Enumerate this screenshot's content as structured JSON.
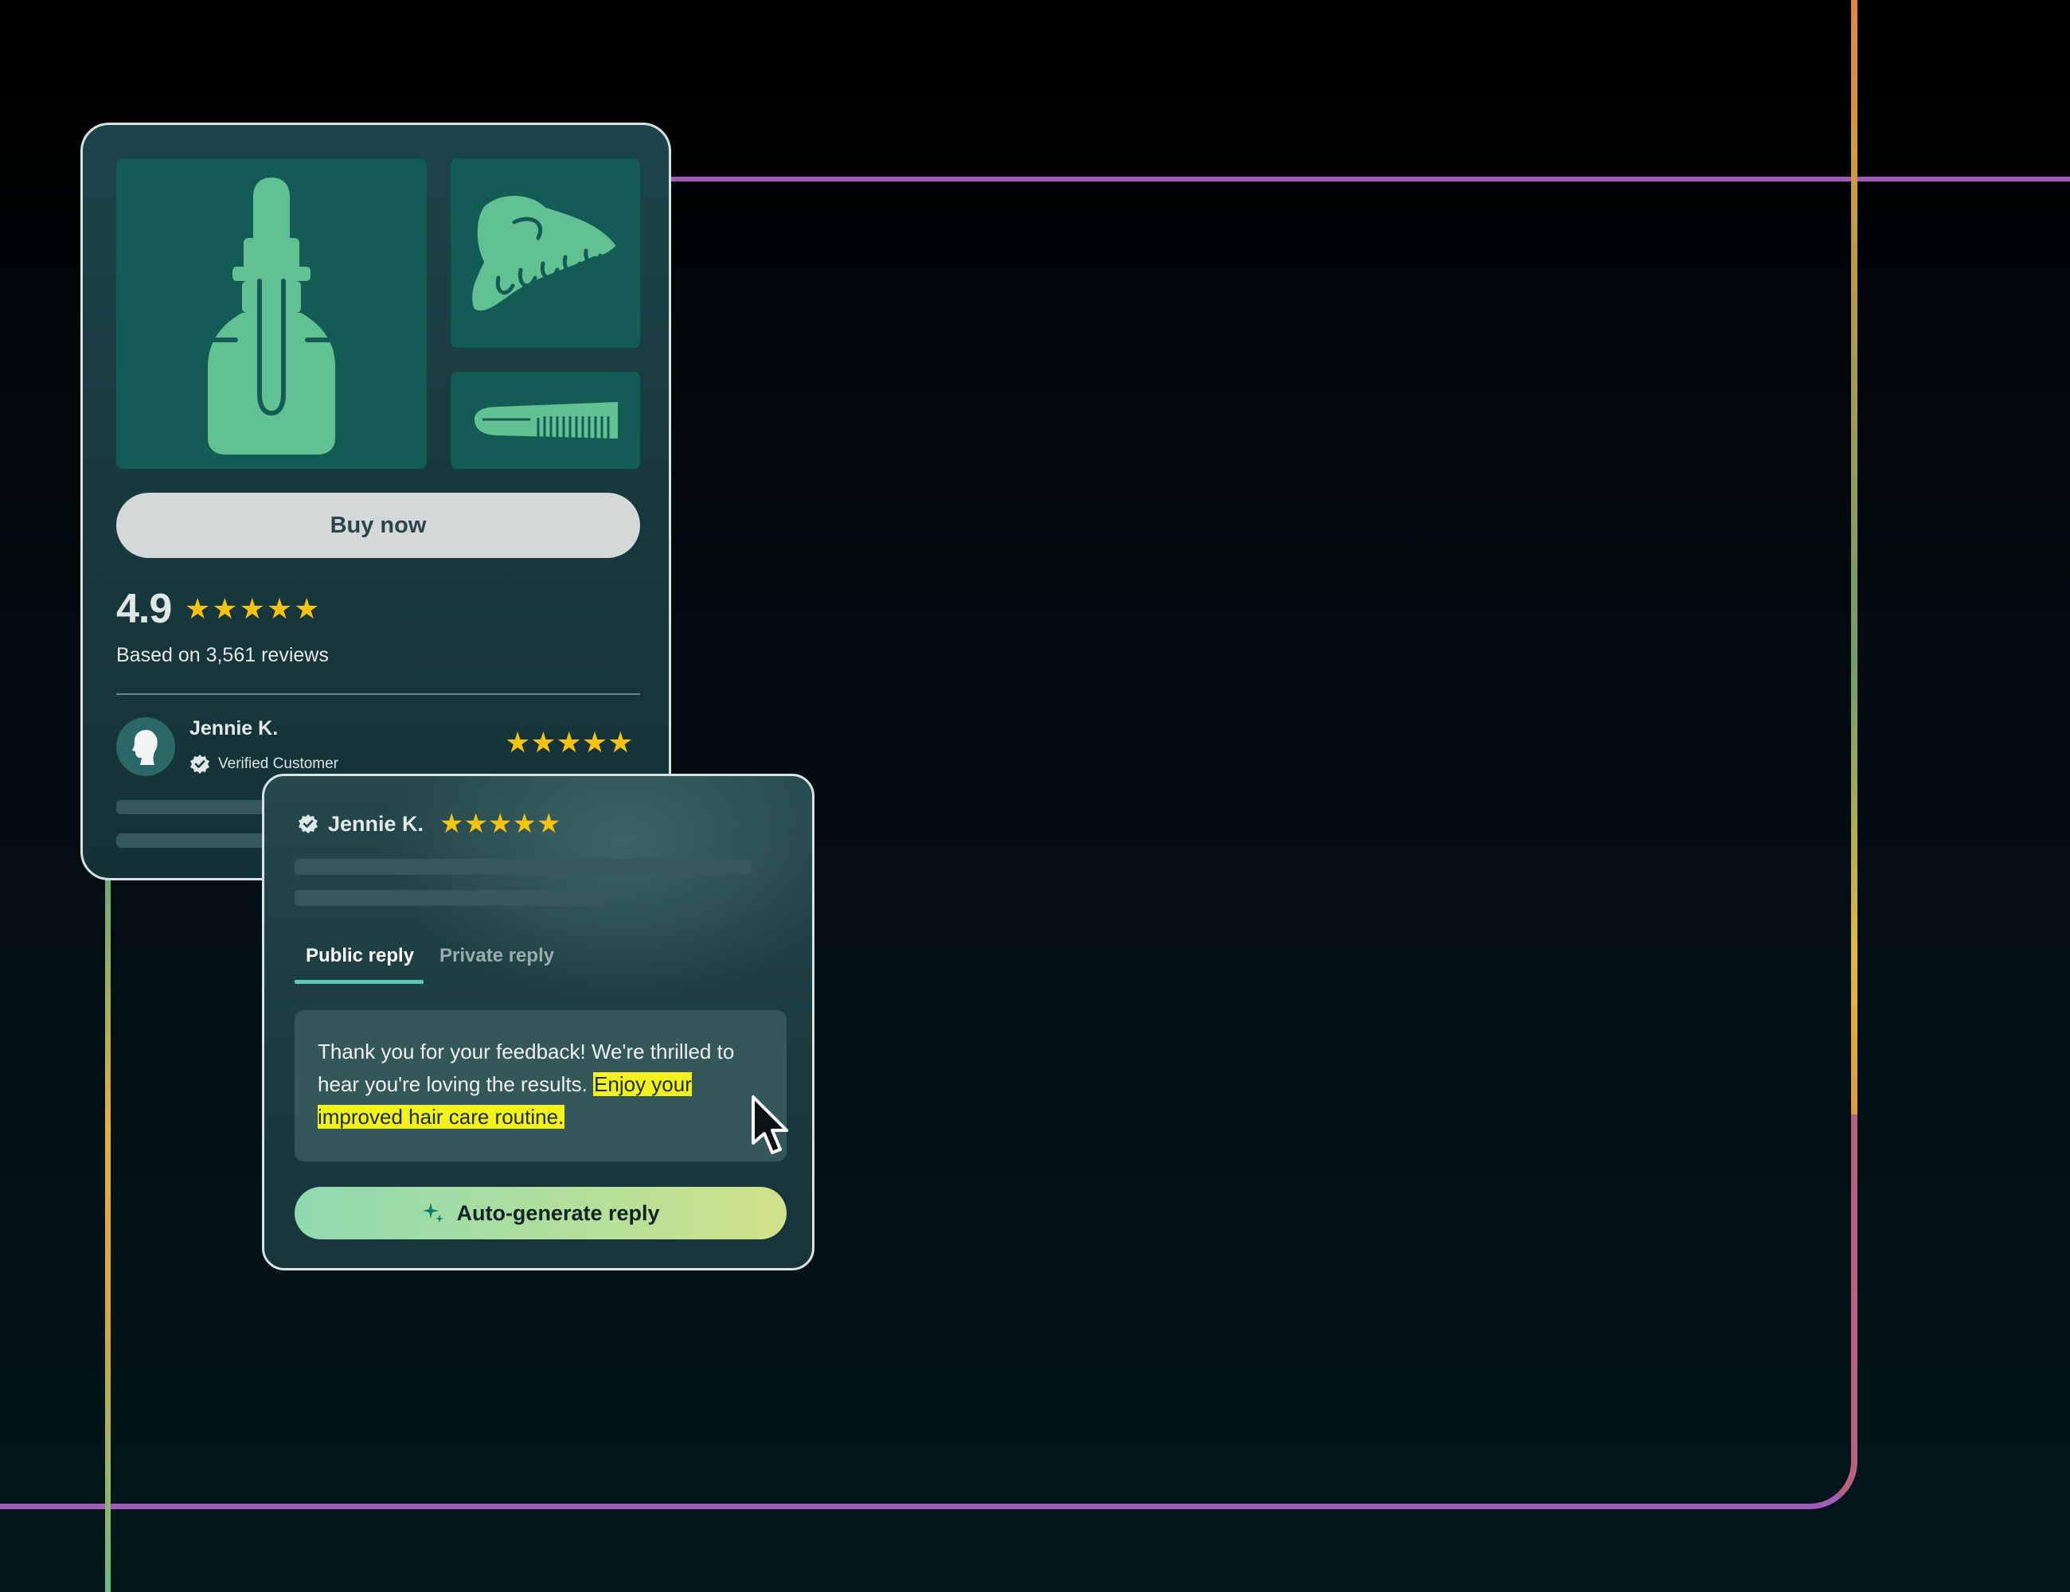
{
  "product_card": {
    "images": [
      "dropper-bottle",
      "hair-claw-clip",
      "comb"
    ],
    "buy_label": "Buy now",
    "rating_value": "4.9",
    "rating_stars": 5,
    "review_count": "Based on 3,561 reviews",
    "review": {
      "name": "Jennie K.",
      "verified_label": "Verified Customer",
      "stars": 5
    }
  },
  "reply_card": {
    "name": "Jennie K.",
    "stars": 5,
    "tabs": {
      "public": "Public reply",
      "private": "Private reply"
    },
    "reply_text_plain": "Thank you for your feedback! We're thrilled to hear you're loving the results. ",
    "reply_text_highlighted": "Enjoy your improved hair care routine.",
    "autogen_label": "Auto-generate reply"
  },
  "colors": {
    "accent_star": "#f6c20f",
    "highlight": "#f3f21d",
    "tab_active": "#5ccbb4",
    "tile": "#125c55"
  }
}
